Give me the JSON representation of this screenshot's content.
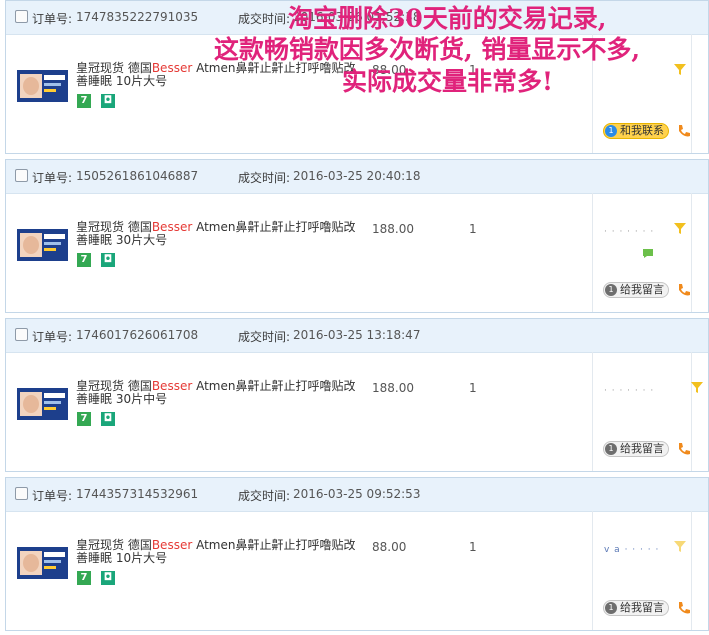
{
  "labels": {
    "order_no": "订单号:",
    "deal_time": "成交时间:"
  },
  "colors": {
    "accent_header": "#e8f2fb",
    "brand_red": "#e53935",
    "overlay_pink": "#e0237b",
    "contact_yellow": "#ffd24d"
  },
  "overlay": {
    "line1": "淘宝删除30天前的交易记录,",
    "line2": "这款畅销款因多次断货, 销量显示不多,",
    "line3": "实际成交量非常多!"
  },
  "orders": [
    {
      "order_number": "1747835222791035",
      "deal_time": "2016-03-26 01:52:38",
      "title_prefix": "皇冠现货 德国",
      "title_brand": "Besser",
      "title_rest": " Atmen鼻鼾止鼾止打呼噜贴改善睡眠 10片大号",
      "price": "88.00",
      "quantity": "1",
      "buyer": "",
      "contact_label": "和我联系",
      "contact_count": "1"
    },
    {
      "order_number": "1505261861046887",
      "deal_time": "2016-03-25 20:40:18",
      "title_prefix": "皇冠现货 德国",
      "title_brand": "Besser",
      "title_rest": " Atmen鼻鼾止鼾止打呼噜贴改善睡眠 30片大号",
      "price": "188.00",
      "quantity": "1",
      "buyer": "· · · · · · ·",
      "contact_label": "给我留言",
      "contact_count": "1"
    },
    {
      "order_number": "1746017626061708",
      "deal_time": "2016-03-25 13:18:47",
      "title_prefix": "皇冠现货 德国",
      "title_brand": "Besser",
      "title_rest": " Atmen鼻鼾止鼾止打呼噜贴改善睡眠 30片中号",
      "price": "188.00",
      "quantity": "1",
      "buyer": "· · · · · · ·",
      "contact_label": "给我留言",
      "contact_count": "1"
    },
    {
      "order_number": "1744357314532961",
      "deal_time": "2016-03-25 09:52:53",
      "title_prefix": "皇冠现货 德国",
      "title_brand": "Besser",
      "title_rest": " Atmen鼻鼾止鼾止打呼噜贴改善睡眠 10片大号",
      "price": "88.00",
      "quantity": "1",
      "buyer": "v a · · · · ·",
      "contact_label": "给我留言",
      "contact_count": "1"
    }
  ]
}
